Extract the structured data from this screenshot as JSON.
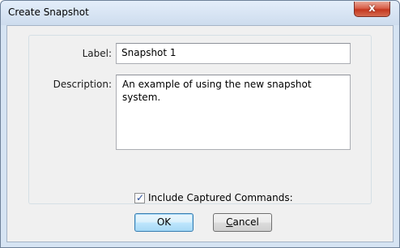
{
  "window": {
    "title": "Create Snapshot",
    "close_symbol": "x"
  },
  "form": {
    "label_caption": "Label:",
    "label_value": "Snapshot 1",
    "description_caption": "Description:",
    "description_value": "An example of using the new snapshot system.",
    "include_captured_label": "Include Captured Commands:",
    "include_captured_checked": true
  },
  "buttons": {
    "ok_label": "OK",
    "cancel_label": "Cancel"
  },
  "colors": {
    "accent": "#3c7fb1",
    "close_button": "#c4371f"
  }
}
